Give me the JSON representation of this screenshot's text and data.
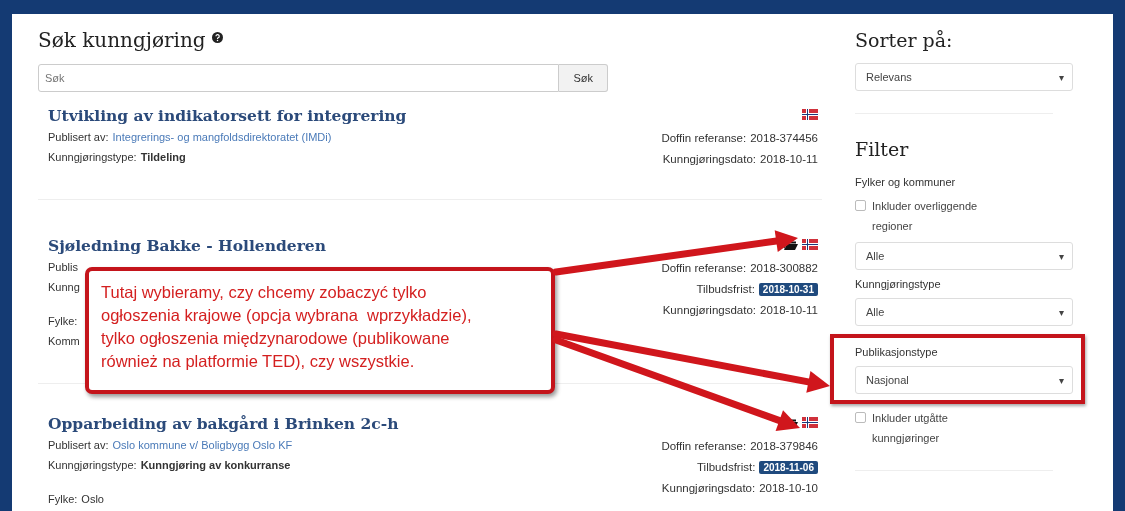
{
  "search": {
    "title": "Søk kunngjøring",
    "placeholder": "Søk",
    "button": "Søk"
  },
  "results": [
    {
      "title": "Utvikling av indikatorsett for integrering",
      "has_folder": false,
      "groups": [
        [
          {
            "label": "Publisert av:",
            "value": "Integrerings- og mangfoldsdirektoratet (IMDi)",
            "kind": "link"
          },
          {
            "label": "Kunngjøringstype:",
            "value": "Tildeling",
            "kind": "bold"
          }
        ]
      ],
      "meta": [
        {
          "label": "Doffin referanse:",
          "value": "2018-374456",
          "kind": "plain"
        },
        {
          "label": "Kunngjøringsdato:",
          "value": "2018-10-11",
          "kind": "plain"
        }
      ]
    },
    {
      "title": "Sjøledning Bakke - Hollenderen",
      "has_folder": true,
      "groups": [
        [
          {
            "label": "Publis"
          },
          {
            "label": "Kunng"
          }
        ],
        [
          {
            "label": "Fylke:"
          },
          {
            "label": "Komm"
          }
        ]
      ],
      "meta": [
        {
          "label": "Doffin referanse:",
          "value": "2018-300882",
          "kind": "plain"
        },
        {
          "label": "Tilbudsfrist:",
          "value": "2018-10-31",
          "kind": "badge"
        },
        {
          "label": "Kunngjøringsdato:",
          "value": "2018-10-11",
          "kind": "plain"
        }
      ]
    },
    {
      "title": "Opparbeiding av bakgård i Brinken 2c-h",
      "has_folder": true,
      "groups": [
        [
          {
            "label": "Publisert av:",
            "value": "Oslo kommune v/ Boligbygg Oslo KF",
            "kind": "link"
          },
          {
            "label": "Kunngjøringstype:",
            "value": "Kunngjøring av konkurranse",
            "kind": "bold"
          }
        ],
        [
          {
            "label": "Fylke:",
            "value": "Oslo",
            "kind": "plain"
          }
        ]
      ],
      "meta": [
        {
          "label": "Doffin referanse:",
          "value": "2018-379846",
          "kind": "plain"
        },
        {
          "label": "Tilbudsfrist:",
          "value": "2018-11-06",
          "kind": "badge"
        },
        {
          "label": "Kunngjøringsdato:",
          "value": "2018-10-10",
          "kind": "plain"
        }
      ]
    }
  ],
  "sort": {
    "title": "Sorter på:",
    "value": "Relevans",
    "caret": "▾"
  },
  "filter": {
    "title": "Filter",
    "items": [
      {
        "kind": "label",
        "text": "Fylker og kommuner"
      },
      {
        "kind": "checkbox",
        "label": "Inkluder overliggende regioner",
        "checked": false
      },
      {
        "kind": "select",
        "value": "Alle",
        "caret": "▾",
        "highlighted": false
      },
      {
        "kind": "select",
        "label": "Kunngjøringstype",
        "value": "Alle",
        "caret": "▾",
        "highlighted": false
      },
      {
        "kind": "select",
        "label": "Publikasjonstype",
        "value": "Nasjonal",
        "caret": "▾",
        "highlighted": true
      },
      {
        "kind": "checkbox",
        "label": "Inkluder utgåtte kunngjøringer",
        "checked": false
      }
    ]
  },
  "callout": {
    "text": "Tutaj wybieramy, czy chcemy zobaczyć tylko\nogłoszenia krajowe (opcja wybrana  wprzykładzie),\ntylko ogłoszenia międzynarodowe (publikowane\nrównież na platformie TED), czy wszystkie."
  }
}
